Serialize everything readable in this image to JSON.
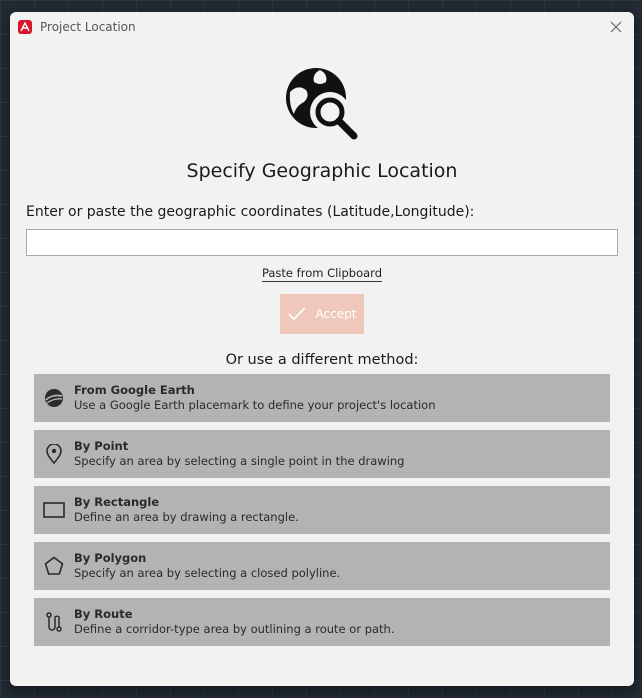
{
  "window": {
    "title": "Project Location",
    "app_icon": "autocad-icon",
    "accent_color": "#d5162d"
  },
  "main": {
    "hero_icon": "globe-search-icon",
    "heading": "Specify Geographic Location",
    "prompt": "Enter or paste the geographic coordinates (Latitude,Longitude):",
    "coordinates_value": "",
    "coordinates_placeholder": "",
    "paste_link": "Paste from Clipboard",
    "accept_label": "Accept",
    "accept_color": "#efc7bb",
    "or_text": "Or use a different method:"
  },
  "methods": [
    {
      "icon": "google-earth-icon",
      "title": "From Google Earth",
      "description": "Use a Google Earth placemark to define your project's location"
    },
    {
      "icon": "map-pin-icon",
      "title": "By Point",
      "description": "Specify an area by selecting a single point in the drawing"
    },
    {
      "icon": "rectangle-icon",
      "title": "By Rectangle",
      "description": "Define an area by drawing a rectangle."
    },
    {
      "icon": "polygon-icon",
      "title": "By Polygon",
      "description": "Specify an area by selecting a closed polyline."
    },
    {
      "icon": "route-icon",
      "title": "By Route",
      "description": "Define a corridor-type area by outlining a route or path."
    }
  ]
}
